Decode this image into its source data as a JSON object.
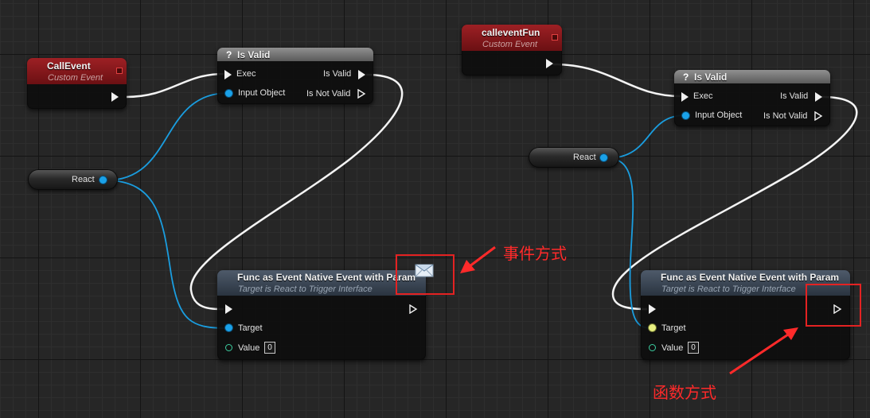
{
  "nodes": {
    "callevent": {
      "title": "CallEvent",
      "subtitle": "Custom Event"
    },
    "calleventfun": {
      "title": "calleventFun",
      "subtitle": "Custom Event"
    },
    "isvalid_left": {
      "icon": "?",
      "title": "Is Valid",
      "exec_in": "Exec",
      "input_object": "Input Object",
      "out_valid": "Is Valid",
      "out_not_valid": "Is Not Valid"
    },
    "isvalid_right": {
      "icon": "?",
      "title": "Is Valid",
      "exec_in": "Exec",
      "input_object": "Input Object",
      "out_valid": "Is Valid",
      "out_not_valid": "Is Not Valid"
    },
    "react_left": {
      "label": "React"
    },
    "react_right": {
      "label": "React"
    },
    "func_left": {
      "title": "Func as Event Native Event with Param",
      "subtitle": "Target is React to Trigger Interface",
      "target": "Target",
      "value_label": "Value",
      "value": "0"
    },
    "func_right": {
      "title": "Func as Event Native Event with Param",
      "subtitle": "Target is React to Trigger Interface",
      "target": "Target",
      "value_label": "Value",
      "value": "0"
    }
  },
  "annotations": {
    "event_style": "事件方式",
    "function_style": "函数方式",
    "color": "#ff2222"
  },
  "icons": {
    "message": "envelope-icon",
    "exec_pin": "exec-arrow-icon",
    "data_pin": "circle-pin-icon"
  },
  "colors": {
    "event_header": "#9d2024",
    "pure_header": "#7a7a7a",
    "call_header": "#3a4654",
    "object_pin": "#1aa1e8",
    "exec_wire": "#ffffff",
    "value_pin": "#3ccea0"
  }
}
